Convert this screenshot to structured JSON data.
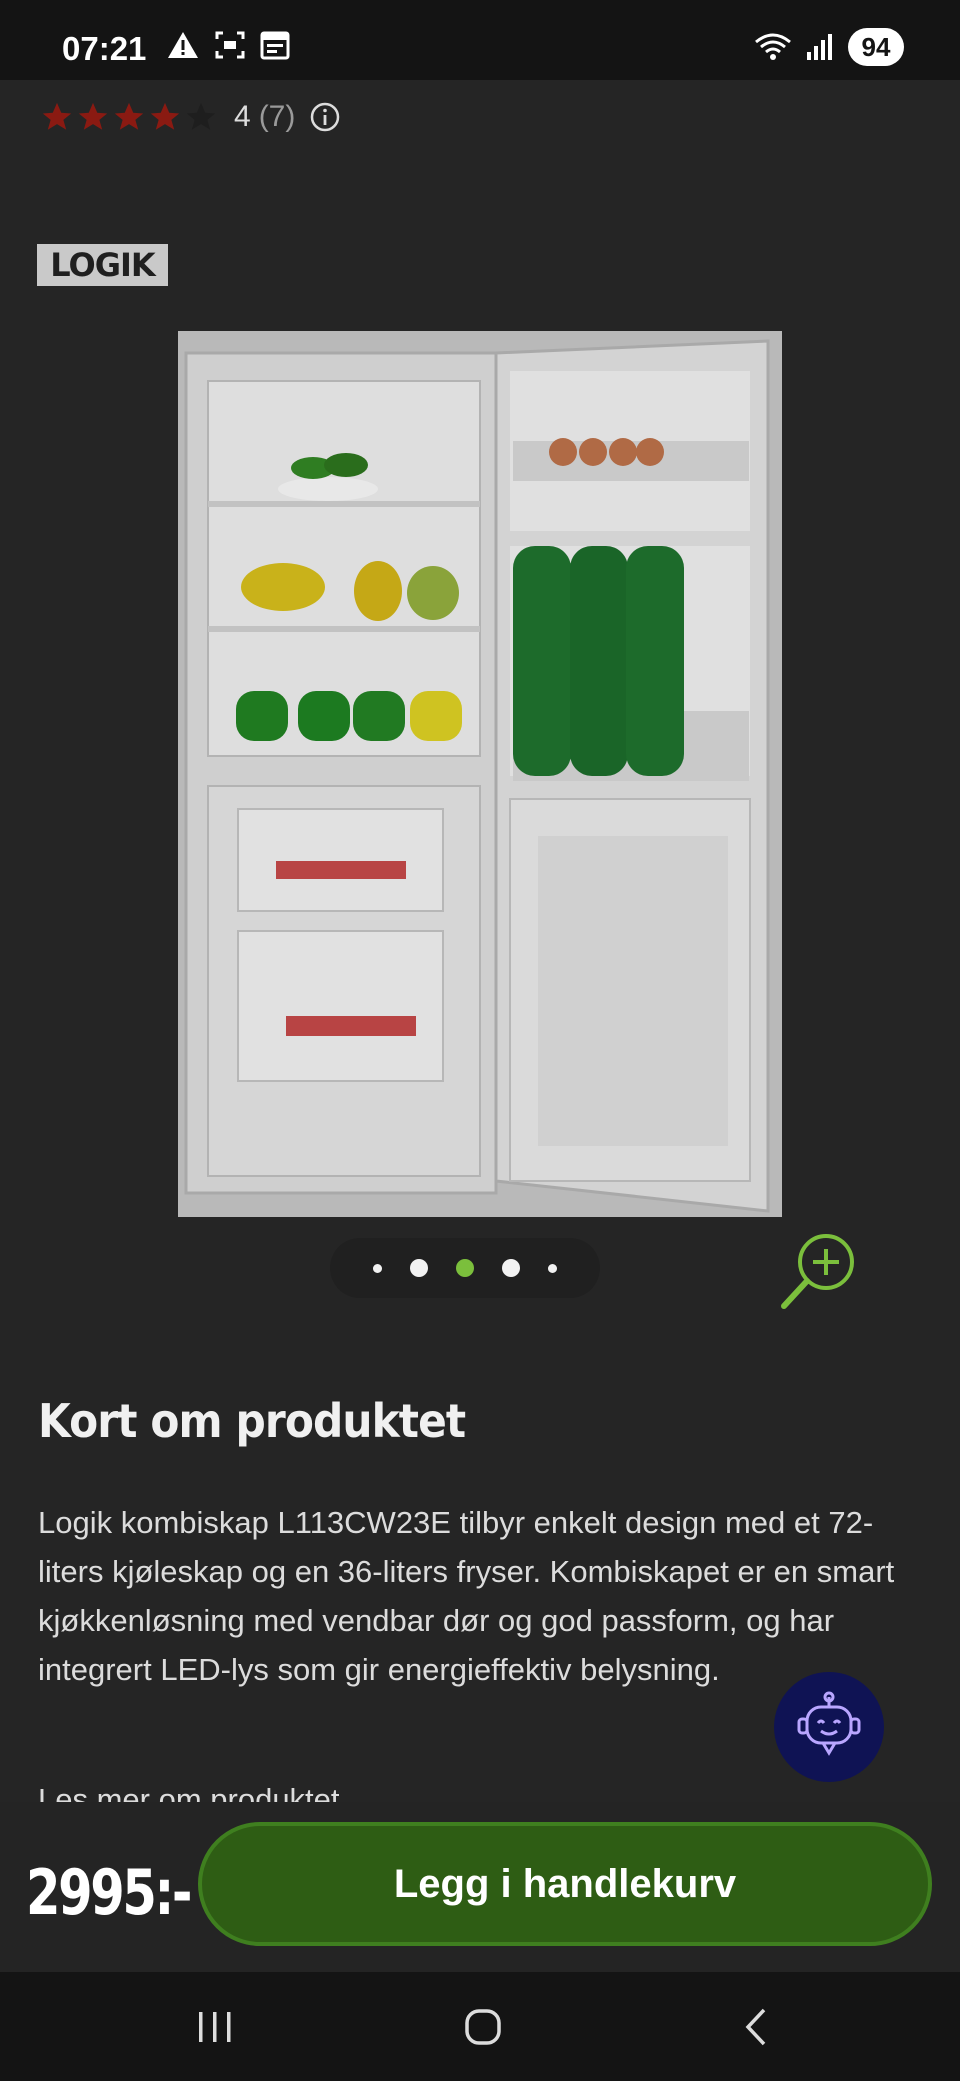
{
  "status_bar": {
    "time": "07:21",
    "battery": "94",
    "icons_left": [
      "warning-icon",
      "screenshot-icon",
      "calendar-icon"
    ],
    "icons_right": [
      "wifi-icon",
      "signal-icon",
      "battery-icon"
    ]
  },
  "rating": {
    "score": "4",
    "count": "(7)",
    "stars_filled": 4,
    "stars_total": 5,
    "star_color": "#8a1a12"
  },
  "brand": {
    "logo_text": "LOGIK"
  },
  "gallery": {
    "image_count": 5,
    "active_index": 2,
    "accent": "#7bbf3c"
  },
  "product": {
    "section_title": "Kort om produktet",
    "description": "Logik kombiskap L113CW23E tilbyr enkelt design med et 72-liters kjøleskap og en 36-liters fryser. Kombiskapet er en smart kjøkkenløsning med vendbar dør og god passform, og har integrert LED-lys som gir energieffektiv belysning.",
    "read_more": "Les mer om produktet"
  },
  "purchase": {
    "price": "2995:-",
    "add_to_cart": "Legg i handlekurv",
    "button_color": "#2e5d14"
  },
  "nav": {
    "buttons": [
      "recents-icon",
      "home-icon",
      "back-icon"
    ]
  }
}
